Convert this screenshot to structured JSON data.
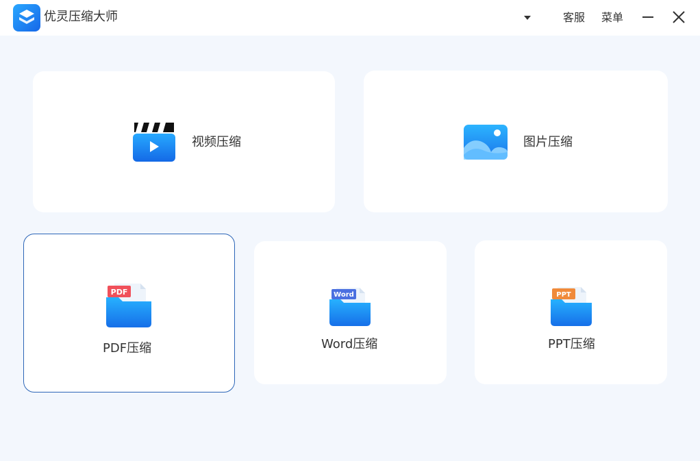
{
  "titlebar": {
    "app_title": "优灵压缩大师",
    "service_label": "客服",
    "menu_label": "菜单"
  },
  "cards": {
    "video": {
      "label": "视频压缩",
      "icon": "video-icon"
    },
    "image": {
      "label": "图片压缩",
      "icon": "image-icon"
    },
    "pdf": {
      "label": "PDF压缩",
      "icon": "pdf-folder-icon",
      "badge": "PDF",
      "badge_color": "#f0505a"
    },
    "word": {
      "label": "Word压缩",
      "icon": "word-folder-icon",
      "badge": "Word",
      "badge_color": "#4a6fe0"
    },
    "ppt": {
      "label": "PPT压缩",
      "icon": "ppt-folder-icon",
      "badge": "PPT",
      "badge_color": "#f08a3a"
    }
  },
  "colors": {
    "accent": "#1a8cf0",
    "selected_border": "#2b65b7",
    "background": "#f3f7fd"
  }
}
